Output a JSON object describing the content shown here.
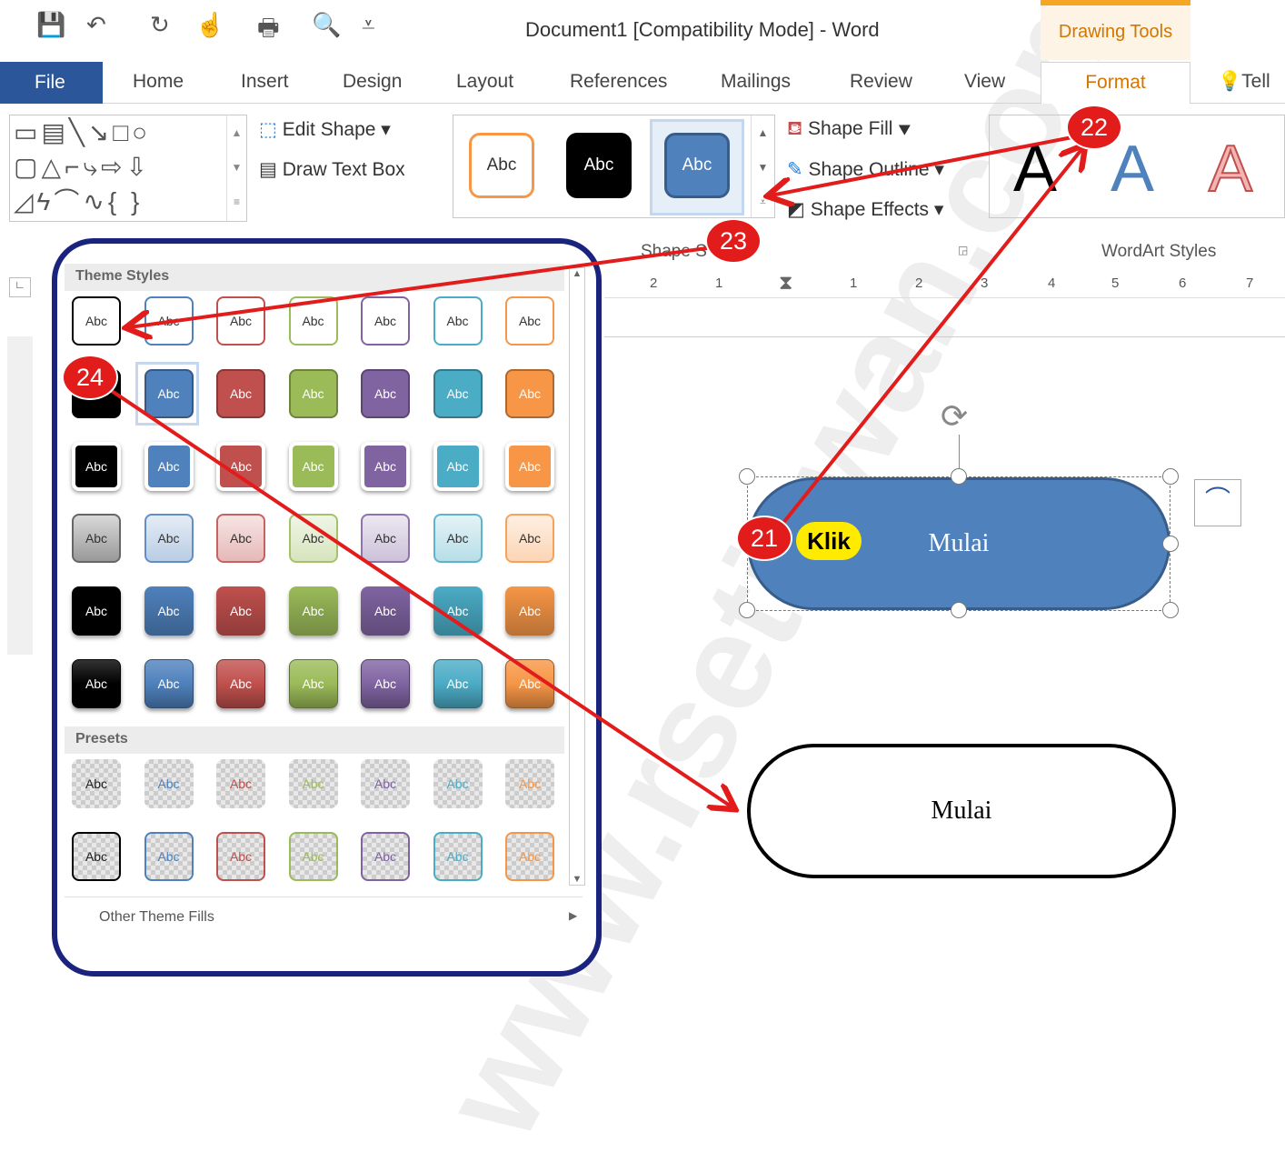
{
  "window": {
    "title": "Document1 [Compatibility Mode] - Word",
    "context_tab": "Drawing Tools"
  },
  "qat": [
    {
      "icon": "save-icon",
      "glyph": "💾"
    },
    {
      "icon": "undo-icon",
      "glyph": "↶"
    },
    {
      "icon": "redo-icon",
      "glyph": "↻"
    },
    {
      "icon": "touch-mode-icon",
      "glyph": "☝"
    },
    {
      "icon": "print-icon",
      "glyph": "🖶"
    },
    {
      "icon": "print-preview-icon",
      "glyph": "🔍"
    },
    {
      "icon": "customize-qat-icon",
      "glyph": "⩡"
    }
  ],
  "tabs": [
    "File",
    "Home",
    "Insert",
    "Design",
    "Layout",
    "References",
    "Mailings",
    "Review",
    "View",
    "Format",
    "Tell"
  ],
  "ribbon": {
    "edit_shape": "Edit Shape",
    "draw_text_box": "Draw Text Box",
    "shape_fill": "Shape Fill",
    "shape_outline": "Shape Outline",
    "shape_effects": "Shape Effects",
    "shape_styles_label": "Shape S",
    "wordart_label": "WordArt Styles",
    "style_sample": "Abc",
    "wordart_letter": "A"
  },
  "gallery": {
    "theme_styles": "Theme Styles",
    "presets": "Presets",
    "other_fills": "Other Theme Fills",
    "sample": "Abc",
    "colors": [
      "#000000",
      "#4f81bd",
      "#c0504d",
      "#9bbb59",
      "#8064a2",
      "#4bacc6",
      "#f79646"
    ],
    "row_styles": [
      "outline",
      "solid-dark-border",
      "solid-white-border",
      "light-gradient",
      "intense",
      "glossy",
      "preset-transparent",
      "preset-outline"
    ]
  },
  "ruler": {
    "labels": [
      "2",
      "1",
      "1",
      "2",
      "3",
      "4",
      "5",
      "6",
      "7"
    ]
  },
  "document": {
    "shape1_text": "Mulai",
    "shape2_text": "Mulai"
  },
  "annotations": {
    "b21": "21",
    "b22": "22",
    "b23": "23",
    "b24": "24",
    "klik": "Klik",
    "color": "#e21b1b"
  },
  "watermark": "www.rsetiawan.com"
}
